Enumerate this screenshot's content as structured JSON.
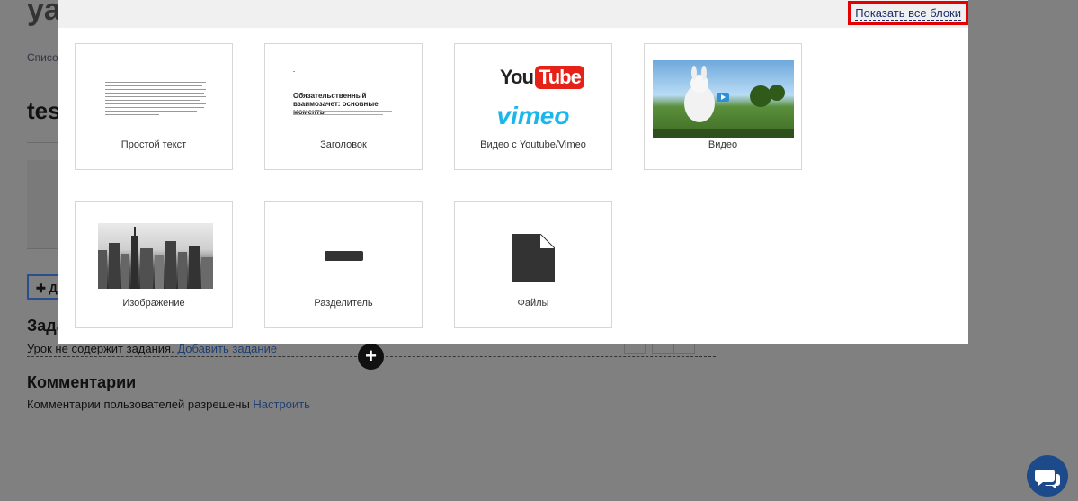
{
  "background": {
    "app_title": "ya",
    "breadcrumb": "Списо",
    "page_heading": "tes",
    "add_button_label": "Д",
    "tasks_heading": "Зада",
    "tasks_text": "Урок не содержит задания.",
    "tasks_link": "Добавить задание",
    "comments_heading": "Комментарии",
    "comments_text": "Комментарии пользователей разрешены",
    "comments_link": "Настроить"
  },
  "modal": {
    "show_all_label": "Показать все блоки",
    "tiles": [
      {
        "label": "Простой текст",
        "preview": "text-preview"
      },
      {
        "label": "Заголовок",
        "preview": "heading-preview",
        "preview_title": "Обязательственный взаимозачет: основные моменты"
      },
      {
        "label": "Видео с Youtube/Vimeo",
        "preview": "youtube-vimeo-logos",
        "you": "You",
        "tube": "Tube",
        "vimeo": "vimeo"
      },
      {
        "label": "Видео",
        "preview": "video-thumbnail"
      },
      {
        "label": "Изображение",
        "preview": "city-image-thumbnail"
      },
      {
        "label": "Разделитель",
        "preview": "divider-icon"
      },
      {
        "label": "Файлы",
        "preview": "file-icon"
      }
    ]
  },
  "colors": {
    "highlight": "#e30000",
    "link": "#1d2f6b",
    "chat_button": "#1d4a8b",
    "vimeo": "#1ab7ea",
    "youtube_red": "#e62117"
  }
}
